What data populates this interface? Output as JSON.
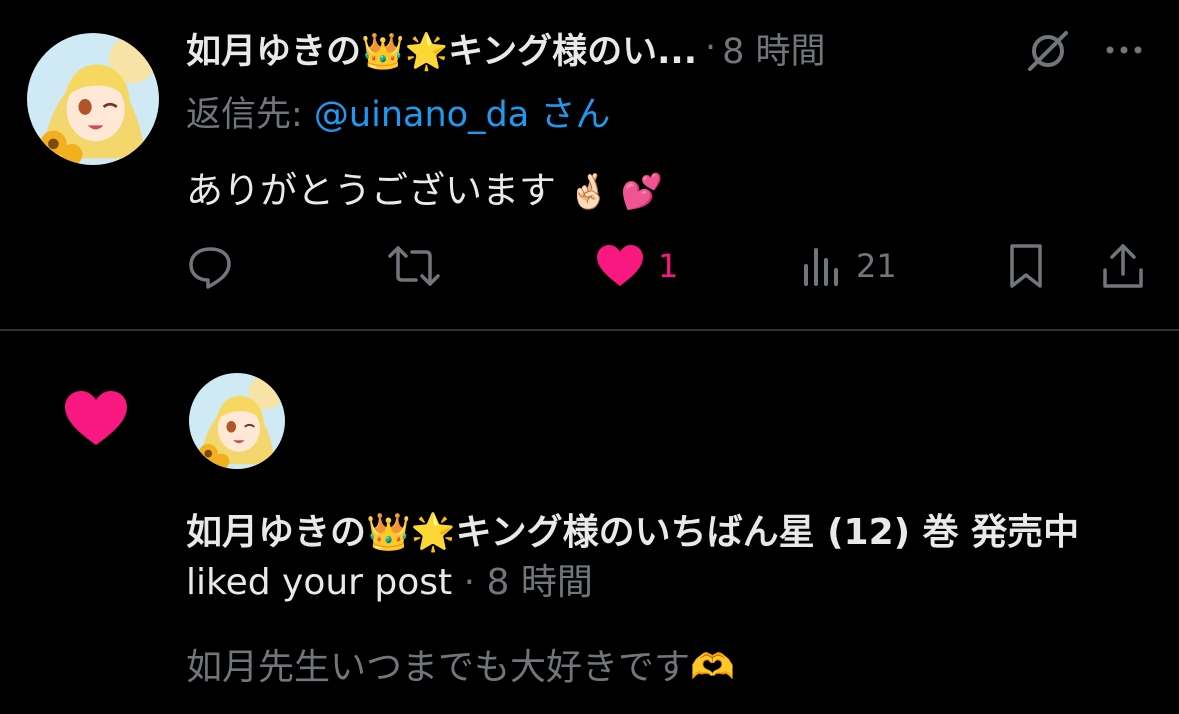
{
  "post": {
    "author_name": "如月ゆきの👑🌟キング様のい...",
    "separator": "·",
    "time": "8 時間",
    "reply_prefix": "返信先: ",
    "reply_handle": "@uinano_da",
    "reply_suffix": " さん",
    "text": "ありがとうございます",
    "text_emoji": "🤞🏻 💕",
    "actions": {
      "reply_icon": "reply-icon",
      "repost_icon": "repost-icon",
      "like_icon": "heart-filled-icon",
      "like_count": "1",
      "views_icon": "views-icon",
      "views_count": "21",
      "bookmark_icon": "bookmark-icon",
      "share_icon": "share-icon"
    },
    "header_icons": [
      "grok-icon",
      "more-icon"
    ]
  },
  "notification": {
    "type_icon": "heart-filled-icon",
    "user_name": "如月ゆきの👑🌟キング様のいちばん星 (12) 巻 発売中",
    "action_text": " liked your post",
    "separator": " · ",
    "time": "8 時間",
    "preview_text": "如月先生いつまでも大好きです🫶"
  },
  "colors": {
    "background": "#000000",
    "text_primary": "#e7e9ea",
    "text_secondary": "#71767b",
    "link": "#1d9bf0",
    "like": "#f91880",
    "divider": "#2f3336"
  }
}
